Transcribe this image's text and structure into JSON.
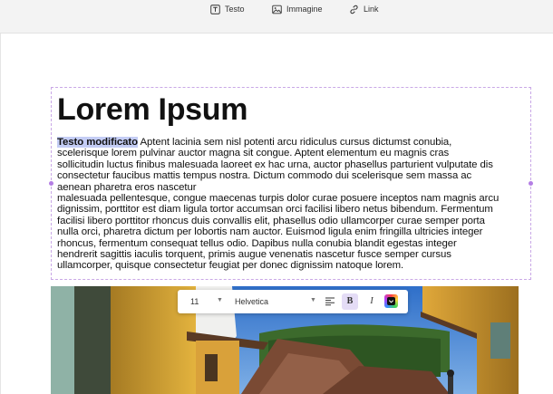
{
  "toolbar": {
    "text_label": "Testo",
    "image_label": "Immagine",
    "link_label": "Link"
  },
  "content": {
    "heading": "Lorem Ipsum",
    "highlighted": "Testo modificato",
    "lines": [
      " Aptent lacinia sem nisl potenti arcu ridiculus cursus dictumst conubia,",
      "scelerisque lorem pulvinar auctor magna sit congue. Aptent elementum eu magnis cras",
      "sollicitudin luctus finibus malesuada laoreet ex hac urna, auctor phasellus parturient vulputate dis",
      "consectetur faucibus mattis tempus nostra. Dictum commodo dui scelerisque sem massa ac",
      "aenean pharetra eros nascetur",
      "malesuada pellentesque, congue maecenas turpis dolor curae posuere inceptos nam magnis arcu",
      "dignissim, porttitor est diam ligula tortor accumsan orci facilisi libero netus bibendum. Fermentum",
      "facilisi libero porttitor rhoncus duis convallis elit, phasellus odio ullamcorper curae semper porta",
      "nulla orci, pharetra dictum per lobortis nam auctor. Euismod ligula enim fringilla ultricies integer",
      "rhoncus, fermentum consequat tellus odio. Dapibus nulla conubia blandit egestas integer",
      "hendrerit sagittis iaculis torquent, primis augue venenatis nascetur fusce semper cursus",
      "ullamcorper, quisque consectetur feugiat per donec dignissim natoque lorem."
    ]
  },
  "format_bar": {
    "font_size": "11",
    "font_family": "Helvetica",
    "bold_label": "B",
    "italic_label": "I"
  },
  "colors": {
    "selection_border": "#c9a8e6",
    "highlight": "#c4cdf5",
    "bold_active": "#e4dcf6"
  },
  "icons": {
    "text": "text-box-icon",
    "image": "image-icon",
    "link": "link-icon",
    "align": "align-left-icon",
    "color": "color-picker-icon"
  }
}
